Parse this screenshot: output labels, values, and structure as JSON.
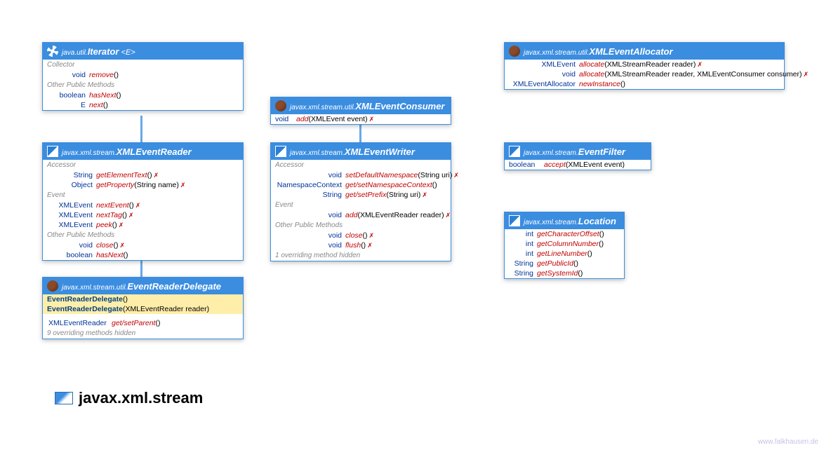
{
  "iterator": {
    "pkg": "java.util.",
    "name": "Iterator",
    "type_param": "<E>",
    "sections": {
      "collector_label": "Collector",
      "other_label": "Other Public Methods"
    },
    "methods": {
      "remove": {
        "ret": "void",
        "name": "remove",
        "params": "()"
      },
      "hasNext": {
        "ret": "boolean",
        "name": "hasNext",
        "params": "()"
      },
      "next": {
        "ret": "E",
        "name": "next",
        "params": "()"
      }
    }
  },
  "xmlEventReader": {
    "pkg": "javax.xml.stream.",
    "name": "XMLEventReader",
    "sections": {
      "accessor": "Accessor",
      "event": "Event",
      "other": "Other Public Methods"
    },
    "methods": {
      "getElementText": {
        "ret": "String",
        "name": "getElementText",
        "params": "()"
      },
      "getProperty": {
        "ret": "Object",
        "name": "getProperty",
        "params": "(String name)"
      },
      "nextEvent": {
        "ret": "XMLEvent",
        "name": "nextEvent",
        "params": "()"
      },
      "nextTag": {
        "ret": "XMLEvent",
        "name": "nextTag",
        "params": "()"
      },
      "peek": {
        "ret": "XMLEvent",
        "name": "peek",
        "params": "()"
      },
      "close": {
        "ret": "void",
        "name": "close",
        "params": "()"
      },
      "hasNext": {
        "ret": "boolean",
        "name": "hasNext",
        "params": "()"
      }
    }
  },
  "eventReaderDelegate": {
    "pkg": "javax.xml.stream.util.",
    "name": "EventReaderDelegate",
    "ctors": {
      "c1": {
        "name": "EventReaderDelegate",
        "params": "()"
      },
      "c2": {
        "name": "EventReaderDelegate",
        "params": "(XMLEventReader reader)"
      }
    },
    "methods": {
      "getSetParent": {
        "ret": "XMLEventReader",
        "name": "get/setParent",
        "params": "()"
      }
    },
    "hidden": "9 overriding methods hidden"
  },
  "xmlEventConsumer": {
    "pkg": "javax.xml.stream.util.",
    "name": "XMLEventConsumer",
    "methods": {
      "add": {
        "ret": "void",
        "name": "add",
        "params": "(XMLEvent event)"
      }
    }
  },
  "xmlEventWriter": {
    "pkg": "javax.xml.stream.",
    "name": "XMLEventWriter",
    "sections": {
      "accessor": "Accessor",
      "event": "Event",
      "other": "Other Public Methods"
    },
    "methods": {
      "setDefaultNamespace": {
        "ret": "void",
        "name": "setDefaultNamespace",
        "params": "(String uri)"
      },
      "getSetNamespaceContext": {
        "ret": "NamespaceContext",
        "name": "get/setNamespaceContext",
        "params": "()"
      },
      "getSetPrefix": {
        "ret": "String",
        "name": "get/setPrefix",
        "params": "(String uri)"
      },
      "add": {
        "ret": "void",
        "name": "add",
        "params": "(XMLEventReader reader)"
      },
      "close": {
        "ret": "void",
        "name": "close",
        "params": "()"
      },
      "flush": {
        "ret": "void",
        "name": "flush",
        "params": "()"
      }
    },
    "hidden": "1 overriding method hidden"
  },
  "xmlEventAllocator": {
    "pkg": "javax.xml.stream.util.",
    "name": "XMLEventAllocator",
    "methods": {
      "allocate1": {
        "ret": "XMLEvent",
        "name": "allocate",
        "params": "(XMLStreamReader reader)"
      },
      "allocate2": {
        "ret": "void",
        "name": "allocate",
        "params": "(XMLStreamReader reader, XMLEventConsumer consumer)"
      },
      "newInstance": {
        "ret": "XMLEventAllocator",
        "name": "newInstance",
        "params": "()"
      }
    }
  },
  "eventFilter": {
    "pkg": "javax.xml.stream.",
    "name": "EventFilter",
    "methods": {
      "accept": {
        "ret": "boolean",
        "name": "accept",
        "params": "(XMLEvent event)"
      }
    }
  },
  "location": {
    "pkg": "javax.xml.stream.",
    "name": "Location",
    "methods": {
      "getCharacterOffset": {
        "ret": "int",
        "name": "getCharacterOffset",
        "params": "()"
      },
      "getColumnNumber": {
        "ret": "int",
        "name": "getColumnNumber",
        "params": "()"
      },
      "getLineNumber": {
        "ret": "int",
        "name": "getLineNumber",
        "params": "()"
      },
      "getPublicId": {
        "ret": "String",
        "name": "getPublicId",
        "params": "()"
      },
      "getSystemId": {
        "ret": "String",
        "name": "getSystemId",
        "params": "()"
      }
    }
  },
  "packageTitle": "javax.xml.stream",
  "watermark": "www.falkhausen.de"
}
